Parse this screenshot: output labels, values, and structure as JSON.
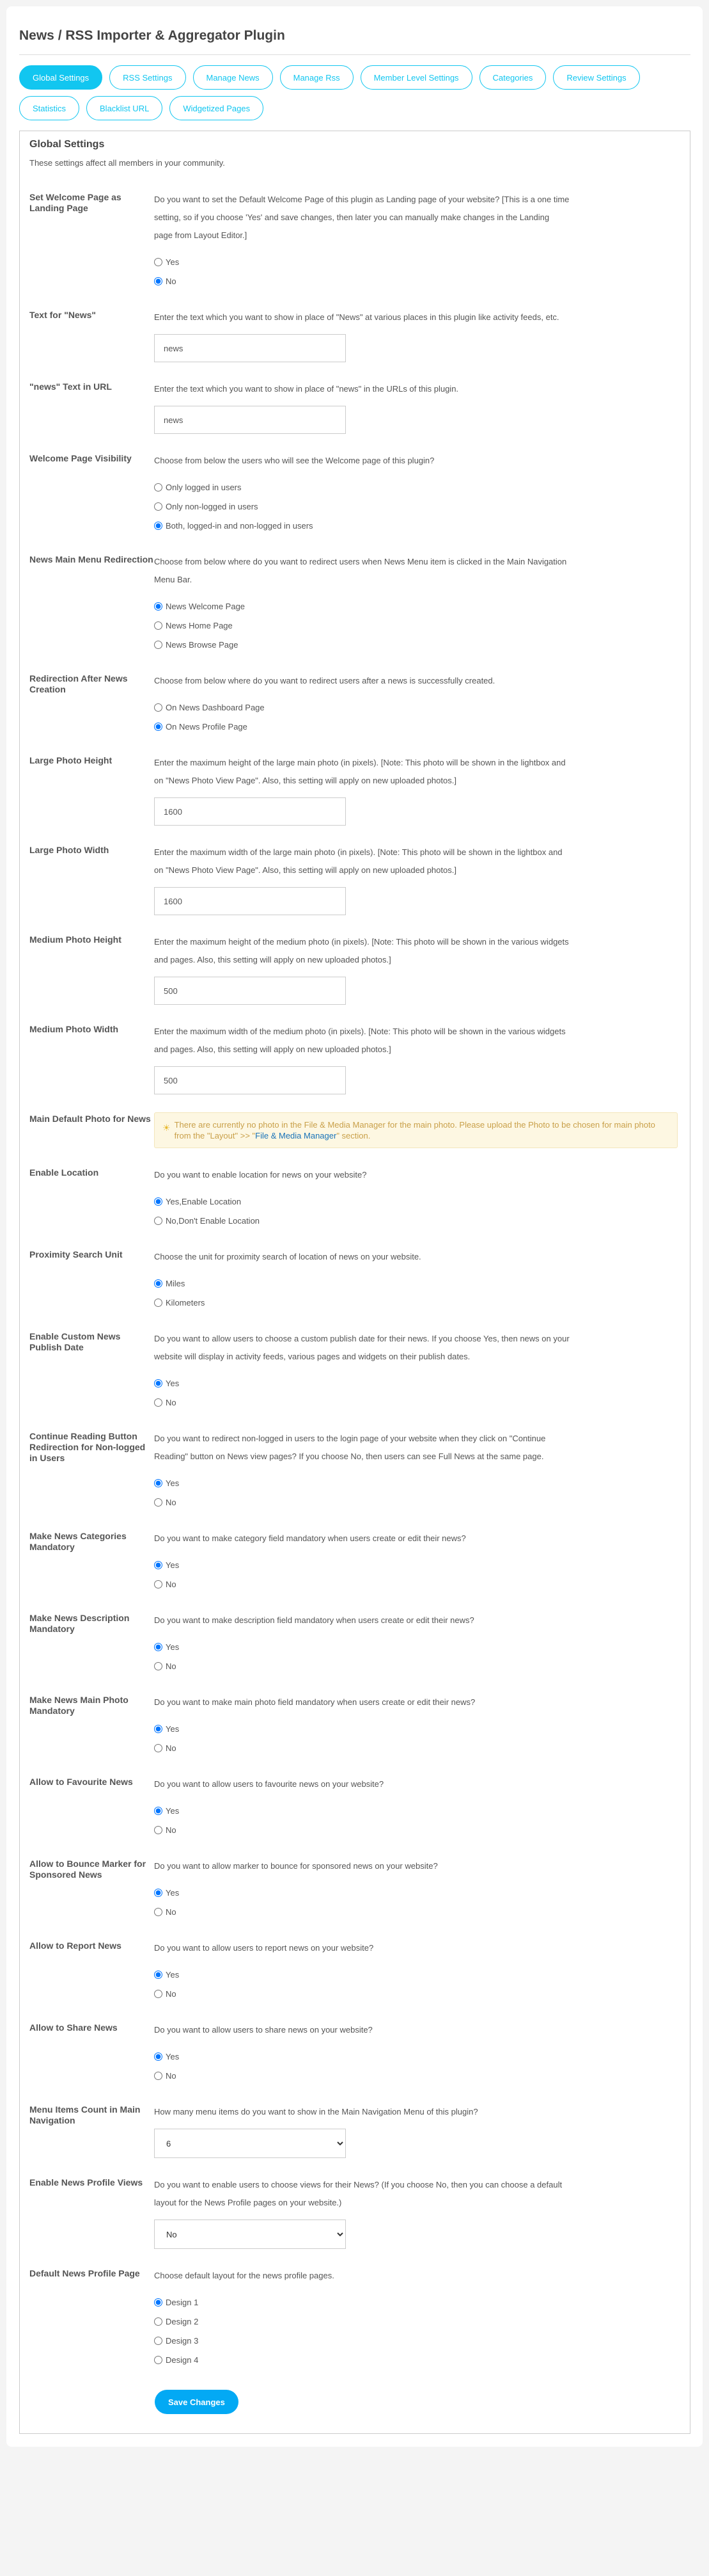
{
  "page_title": "News / RSS Importer & Aggregator Plugin",
  "tabs": [
    {
      "label": "Global Settings",
      "active": true
    },
    {
      "label": "RSS Settings"
    },
    {
      "label": "Manage News"
    },
    {
      "label": "Manage Rss"
    },
    {
      "label": "Member Level Settings"
    },
    {
      "label": "Categories"
    },
    {
      "label": "Review Settings"
    },
    {
      "label": "Statistics"
    },
    {
      "label": "Blacklist URL"
    },
    {
      "label": "Widgetized Pages"
    }
  ],
  "section": {
    "title": "Global Settings",
    "intro": "These settings affect all members in your community."
  },
  "settings": [
    {
      "label": "Set Welcome Page as Landing Page",
      "desc": "Do you want to set the Default Welcome Page of this plugin as Landing page of your website? [This is a one time setting, so if you choose 'Yes' and save changes, then later you can manually make changes in the Landing page from Layout Editor.]",
      "type": "radio",
      "options": [
        "Yes",
        "No"
      ],
      "selected": 1
    },
    {
      "label": "Text for \"News\"",
      "desc": "Enter the text which you want to show in place of \"News\" at various places in this plugin like activity feeds, etc.",
      "type": "text",
      "value": "news"
    },
    {
      "label": "\"news\" Text in URL",
      "desc": "Enter the text which you want to show in place of \"news\" in the URLs of this plugin.",
      "type": "text",
      "value": "news"
    },
    {
      "label": "Welcome Page Visibility",
      "desc": "Choose from below the users who will see the Welcome page of this plugin?",
      "type": "radio",
      "options": [
        "Only logged in users",
        "Only non-logged in users",
        "Both, logged-in and non-logged in users"
      ],
      "selected": 2
    },
    {
      "label": "News Main Menu Redirection",
      "desc": "Choose from below where do you want to redirect users when News Menu item is clicked in the Main Navigation Menu Bar.",
      "type": "radio",
      "options": [
        "News Welcome Page",
        "News Home Page",
        "News Browse Page"
      ],
      "selected": 0
    },
    {
      "label": "Redirection After News Creation",
      "desc": "Choose from below where do you want to redirect users after a news is successfully created.",
      "type": "radio",
      "options": [
        "On News Dashboard Page",
        "On News Profile Page"
      ],
      "selected": 1
    },
    {
      "label": "Large Photo Height",
      "desc": "Enter the maximum height of the large main photo (in pixels). [Note: This photo will be shown in the lightbox and on \"News Photo View Page\". Also, this setting will apply on new uploaded photos.]",
      "type": "text",
      "value": "1600"
    },
    {
      "label": "Large Photo Width",
      "desc": "Enter the maximum width of the large main photo (in pixels). [Note: This photo will be shown in the lightbox and on \"News Photo View Page\". Also, this setting will apply on new uploaded photos.]",
      "type": "text",
      "value": "1600"
    },
    {
      "label": "Medium Photo Height",
      "desc": "Enter the maximum height of the medium photo (in pixels). [Note: This photo will be shown in the various widgets and pages. Also, this setting will apply on new uploaded photos.]",
      "type": "text",
      "value": "500"
    },
    {
      "label": "Medium Photo Width",
      "desc": "Enter the maximum width of the medium photo (in pixels). [Note: This photo will be shown in the various widgets and pages. Also, this setting will apply on new uploaded photos.]",
      "type": "text",
      "value": "500"
    },
    {
      "label": "Main Default Photo for News",
      "type": "notice",
      "icon": "lightbulb-icon",
      "notice_before": "There are currently no photo in the File & Media Manager for the main photo. Please upload the Photo to be chosen for main photo from the \"Layout\" >> \"",
      "notice_link": "File & Media Manager",
      "notice_after": "\" section."
    },
    {
      "label": "Enable Location",
      "desc": "Do you want to enable location for news on your website?",
      "type": "radio",
      "options": [
        "Yes,Enable Location",
        "No,Don't Enable Location"
      ],
      "selected": 0
    },
    {
      "label": "Proximity Search Unit",
      "desc": "Choose the unit for proximity search of location of news on your website.",
      "type": "radio",
      "options": [
        "Miles",
        "Kilometers"
      ],
      "selected": 0
    },
    {
      "label": "Enable Custom News Publish Date",
      "desc": "Do you want to allow users to choose a custom publish date for their news. If you choose Yes, then news on your website will display in activity feeds, various pages and widgets on their publish dates.",
      "type": "radio",
      "options": [
        "Yes",
        "No"
      ],
      "selected": 0
    },
    {
      "label": "Continue Reading Button Redirection for Non-logged in Users",
      "desc": "Do you want to redirect non-logged in users to the login page of your website when they click on \"Continue Reading\" button on News view pages? If you choose No, then users can see Full News at the same page.",
      "type": "radio",
      "options": [
        "Yes",
        "No"
      ],
      "selected": 0
    },
    {
      "label": "Make News Categories Mandatory",
      "desc": "Do you want to make category field mandatory when users create or edit their news?",
      "type": "radio",
      "options": [
        "Yes",
        "No"
      ],
      "selected": 0
    },
    {
      "label": "Make News Description Mandatory",
      "desc": "Do you want to make description field mandatory when users create or edit their news?",
      "type": "radio",
      "options": [
        "Yes",
        "No"
      ],
      "selected": 0
    },
    {
      "label": "Make News Main Photo Mandatory",
      "desc": "Do you want to make main photo field mandatory when users create or edit their news?",
      "type": "radio",
      "options": [
        "Yes",
        "No"
      ],
      "selected": 0
    },
    {
      "label": "Allow to Favourite News",
      "desc": "Do you want to allow users to favourite news on your website?",
      "type": "radio",
      "options": [
        "Yes",
        "No"
      ],
      "selected": 0
    },
    {
      "label": "Allow to Bounce Marker for Sponsored News",
      "desc": "Do you want to allow marker to bounce for sponsored news on your website?",
      "type": "radio",
      "options": [
        "Yes",
        "No"
      ],
      "selected": 0
    },
    {
      "label": "Allow to Report News",
      "desc": "Do you want to allow users to report news on your website?",
      "type": "radio",
      "options": [
        "Yes",
        "No"
      ],
      "selected": 0
    },
    {
      "label": "Allow to Share News",
      "desc": "Do you want to allow users to share news on your website?",
      "type": "radio",
      "options": [
        "Yes",
        "No"
      ],
      "selected": 0
    },
    {
      "label": "Menu Items Count in Main Navigation",
      "desc": "How many menu items do you want to show in the Main Navigation Menu of this plugin?",
      "type": "select",
      "value": "6"
    },
    {
      "label": "Enable News Profile Views",
      "desc": "Do you want to enable users to choose views for their News? (If you choose No, then you can choose a default layout for the News Profile pages on your website.)",
      "type": "select",
      "value": "No"
    },
    {
      "label": "Default News Profile Page",
      "desc": "Choose default layout for the news profile pages.",
      "type": "radio",
      "options": [
        "Design 1",
        "Design 2",
        "Design 3",
        "Design 4"
      ],
      "selected": 0
    }
  ],
  "save_label": "Save Changes",
  "colors": {
    "accent": "#12c6f0",
    "save_button": "#03a9f4",
    "notice_bg": "#fdf7e2",
    "notice_text": "#c9a04a",
    "link": "#1a73b8"
  }
}
